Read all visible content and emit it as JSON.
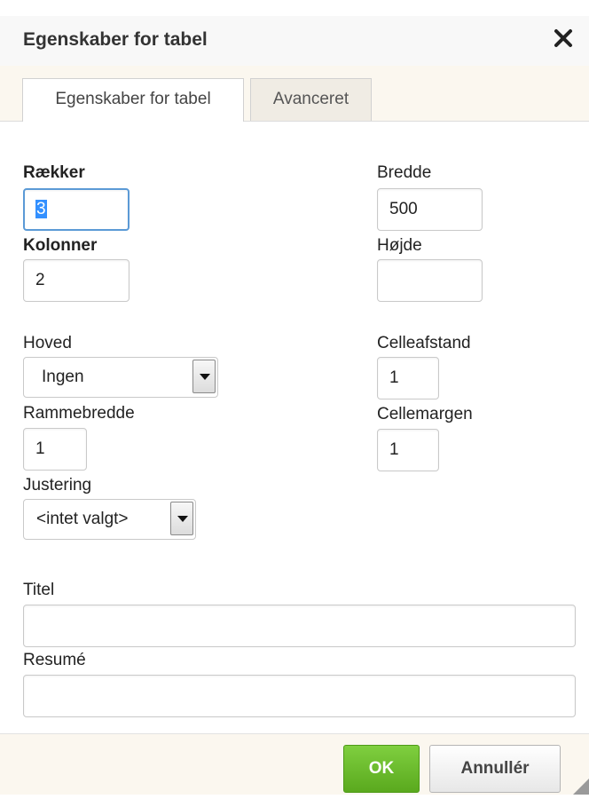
{
  "dialog": {
    "title": "Egenskaber for tabel",
    "close_icon": "close-icon"
  },
  "tabs": [
    {
      "label": "Egenskaber for tabel",
      "active": true
    },
    {
      "label": "Avanceret",
      "active": false
    }
  ],
  "form": {
    "rows_label": "Rækker",
    "rows_value": "3",
    "columns_label": "Kolonner",
    "columns_value": "2",
    "width_label": "Bredde",
    "width_value": "500",
    "height_label": "Højde",
    "height_value": "",
    "header_label": "Hoved",
    "header_value": "Ingen",
    "cellspacing_label": "Celleafstand",
    "cellspacing_value": "1",
    "border_label": "Rammebredde",
    "border_value": "1",
    "cellpadding_label": "Cellemargen",
    "cellpadding_value": "1",
    "align_label": "Justering",
    "align_value": "<intet valgt>",
    "caption_label": "Titel",
    "caption_value": "",
    "summary_label": "Resumé",
    "summary_value": ""
  },
  "footer": {
    "ok_label": "OK",
    "cancel_label": "Annullér"
  },
  "colors": {
    "ok_green": "#6bbf2e",
    "focus_blue": "#5b9ad6",
    "band_bg": "#fbf7ef"
  }
}
